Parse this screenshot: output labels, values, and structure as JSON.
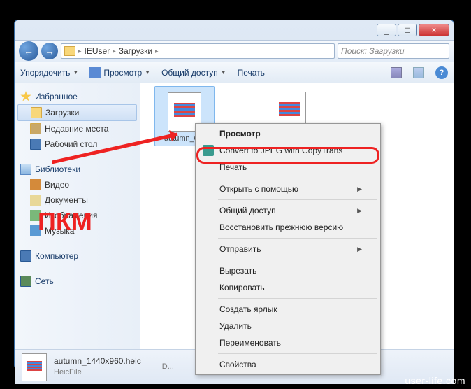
{
  "titlebar": {
    "min": "_",
    "max": "□",
    "close": "×"
  },
  "breadcrumb": {
    "p1": "IEUser",
    "p2": "Загрузки"
  },
  "search": {
    "placeholder": "Поиск: Загрузки"
  },
  "toolbar": {
    "organize": "Упорядочить",
    "preview": "Просмотр",
    "share": "Общий доступ",
    "print": "Печать"
  },
  "sidebar": {
    "favorites": "Избранное",
    "favitems": [
      "Загрузки",
      "Недавние места",
      "Рабочий стол"
    ],
    "libraries": "Библиотеки",
    "libitems": [
      "Видео",
      "Документы",
      "Изображения",
      "Музыка"
    ],
    "computer": "Компьютер",
    "network": "Сеть"
  },
  "files": {
    "f1": "autumn_0...",
    "f2": ""
  },
  "context": {
    "items": [
      "Просмотр",
      "Convert to JPEG with CopyTrans",
      "Печать",
      "Открыть с помощью",
      "Общий доступ",
      "Восстановить прежнюю версию",
      "Отправить",
      "Вырезать",
      "Копировать",
      "Создать ярлык",
      "Удалить",
      "Переименовать",
      "Свойства"
    ]
  },
  "annotation": "ПКМ",
  "status": {
    "name": "autumn_1440x960.heic",
    "type": "HeicFile",
    "date_label": "D..."
  },
  "watermark": "user-life.com"
}
